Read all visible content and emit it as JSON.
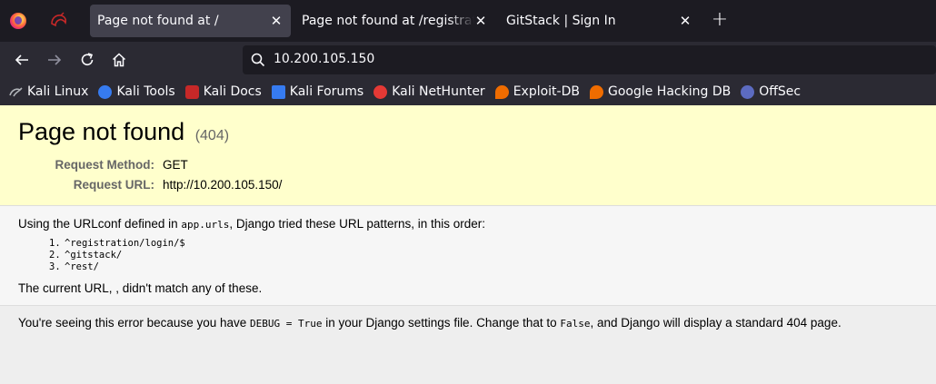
{
  "browser": {
    "tabs": [
      {
        "label": "Page not found at /",
        "active": true
      },
      {
        "label": "Page not found at /registration",
        "active": false
      },
      {
        "label": "GitStack | Sign In",
        "active": false
      }
    ],
    "new_tab": "+",
    "url": "10.200.105.150"
  },
  "bookmarks": [
    {
      "label": "Kali Linux",
      "icon": "kali-dragon-icon",
      "color": "#9aa0a6"
    },
    {
      "label": "Kali Tools",
      "icon": "kali-tools-icon",
      "color": "#367bf0"
    },
    {
      "label": "Kali Docs",
      "icon": "kali-docs-icon",
      "color": "#d32f2f"
    },
    {
      "label": "Kali Forums",
      "icon": "kali-forums-icon",
      "color": "#367bf0"
    },
    {
      "label": "Kali NetHunter",
      "icon": "nethunter-icon",
      "color": "#e53935"
    },
    {
      "label": "Exploit-DB",
      "icon": "exploit-db-icon",
      "color": "#ef6c00"
    },
    {
      "label": "Google Hacking DB",
      "icon": "ghdb-icon",
      "color": "#ef6c00"
    },
    {
      "label": "OffSec",
      "icon": "offsec-icon",
      "color": "#5c6bc0"
    }
  ],
  "page": {
    "title": "Page not found",
    "code": "(404)",
    "request_method_label": "Request Method:",
    "request_method": "GET",
    "request_url_label": "Request URL:",
    "request_url": "http://10.200.105.150/",
    "urlconf_prefix": "Using the URLconf defined in ",
    "urlconf_module": "app.urls",
    "urlconf_suffix": ", Django tried these URL patterns, in this order:",
    "patterns": [
      {
        "num": "1.",
        "pattern": "^registration/login/$"
      },
      {
        "num": "2.",
        "pattern": "^gitstack/"
      },
      {
        "num": "3.",
        "pattern": "^rest/"
      }
    ],
    "current_url_msg": "The current URL, , didn't match any of these.",
    "explanation_1": "You're seeing this error because you have ",
    "debug_code": "DEBUG = True",
    "explanation_2": " in your Django settings file. Change that to ",
    "false_code": "False",
    "explanation_3": ", and Django will display a standard 404 page."
  }
}
